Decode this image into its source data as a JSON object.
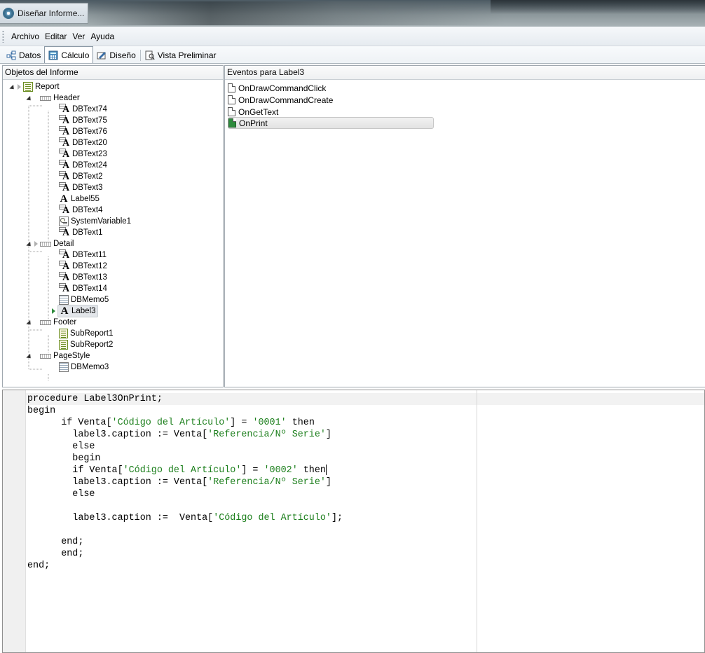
{
  "window": {
    "title": "Diseñar Informe..."
  },
  "menu": [
    "Archivo",
    "Editar",
    "Ver",
    "Ayuda"
  ],
  "tabs": [
    {
      "label": "Datos",
      "icon": "data-pipeline-icon",
      "active": false
    },
    {
      "label": "Cálculo",
      "icon": "calculator-icon",
      "active": true
    },
    {
      "label": "Diseño",
      "icon": "design-icon",
      "active": false
    },
    {
      "label": "Vista Preliminar",
      "icon": "preview-icon",
      "active": false
    }
  ],
  "objects_panel": {
    "header": "Objetos del Informe",
    "tree": [
      {
        "label": "Report",
        "icon": "report-icon",
        "level": 0
      },
      {
        "label": "Header",
        "icon": "band-icon",
        "level": 1
      },
      {
        "label": "DBText74",
        "icon": "dbtext-icon",
        "level": 2
      },
      {
        "label": "DBText75",
        "icon": "dbtext-icon",
        "level": 2
      },
      {
        "label": "DBText76",
        "icon": "dbtext-icon",
        "level": 2
      },
      {
        "label": "DBText20",
        "icon": "dbtext-icon",
        "level": 2
      },
      {
        "label": "DBText23",
        "icon": "dbtext-icon",
        "level": 2
      },
      {
        "label": "DBText24",
        "icon": "dbtext-icon",
        "level": 2
      },
      {
        "label": "DBText2",
        "icon": "dbtext-icon",
        "level": 2
      },
      {
        "label": "DBText3",
        "icon": "dbtext-icon",
        "level": 2
      },
      {
        "label": "Label55",
        "icon": "label-icon",
        "level": 2
      },
      {
        "label": "DBText4",
        "icon": "dbtext-icon",
        "level": 2
      },
      {
        "label": "SystemVariable1",
        "icon": "system-variable-icon",
        "level": 2
      },
      {
        "label": "DBText1",
        "icon": "dbtext-icon",
        "level": 2
      },
      {
        "label": "Detail",
        "icon": "band-icon",
        "level": 1
      },
      {
        "label": "DBText11",
        "icon": "dbtext-icon",
        "level": 2
      },
      {
        "label": "DBText12",
        "icon": "dbtext-icon",
        "level": 2
      },
      {
        "label": "DBText13",
        "icon": "dbtext-icon",
        "level": 2
      },
      {
        "label": "DBText14",
        "icon": "dbtext-icon",
        "level": 2
      },
      {
        "label": "DBMemo5",
        "icon": "dbmemo-icon",
        "level": 2
      },
      {
        "label": "Label3",
        "icon": "label-icon",
        "level": 2,
        "selected": true
      },
      {
        "label": "Footer",
        "icon": "band-icon",
        "level": 1
      },
      {
        "label": "SubReport1",
        "icon": "subreport-icon",
        "level": 2
      },
      {
        "label": "SubReport2",
        "icon": "subreport-icon",
        "level": 2
      },
      {
        "label": "PageStyle",
        "icon": "band-icon",
        "level": 1
      },
      {
        "label": "DBMemo3",
        "icon": "dbmemo-icon",
        "level": 2
      }
    ]
  },
  "events_panel": {
    "header": "Eventos para Label3",
    "events": [
      {
        "label": "OnDrawCommandClick",
        "has_code": false
      },
      {
        "label": "OnDrawCommandCreate",
        "has_code": false
      },
      {
        "label": "OnGetText",
        "has_code": false
      },
      {
        "label": "OnPrint",
        "has_code": true,
        "selected": true
      }
    ]
  },
  "code": {
    "lines": [
      "procedure Label3OnPrint;",
      "begin",
      "      if Venta['Código del Artículo'] = '0001' then",
      "        label3.caption := Venta['Referencia/Nº Serie']",
      "        else",
      "        begin",
      "        if Venta['Código del Artículo'] = '0002' then",
      "        label3.caption := Venta['Referencia/Nº Serie']",
      "        else",
      "",
      "        label3.caption :=  Venta['Código del Artículo'];",
      "",
      "      end;",
      "      end;",
      "end;"
    ],
    "string_color": "#1c7f1c"
  }
}
